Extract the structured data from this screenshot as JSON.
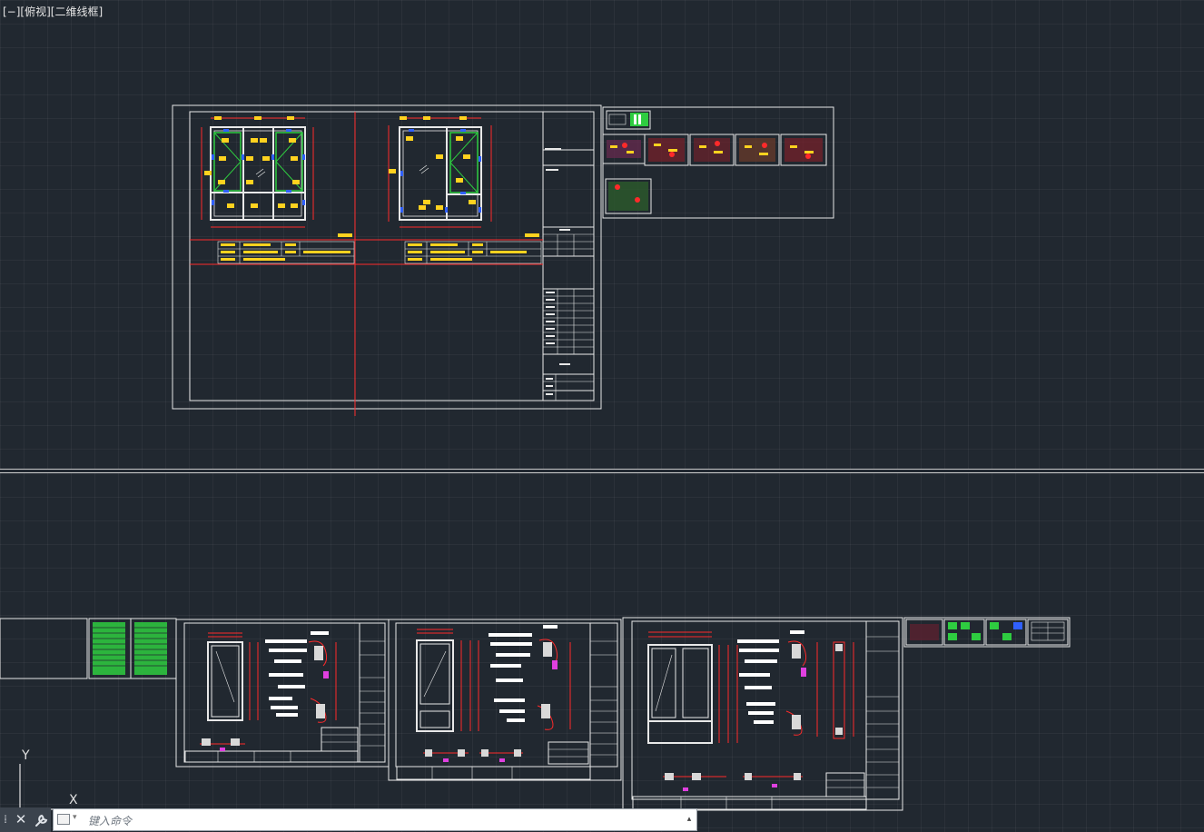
{
  "viewport": {
    "label": "[−][俯视][二维线框]"
  },
  "ucs": {
    "y_label": "Y",
    "x_label": "X"
  },
  "command_line": {
    "placeholder": "键入命令",
    "close_symbol": "✕",
    "customize_symbol": "🔧",
    "grip_symbol": "⁞"
  },
  "colors": {
    "background": "#212830",
    "grid": "#2b333d",
    "drawing_white": "#e8e8e8",
    "drawing_red": "#ff2a2a",
    "drawing_yellow": "#ffd21f",
    "drawing_green": "#2ecc40",
    "drawing_blue": "#3060ff",
    "drawing_magenta": "#e040e0"
  }
}
